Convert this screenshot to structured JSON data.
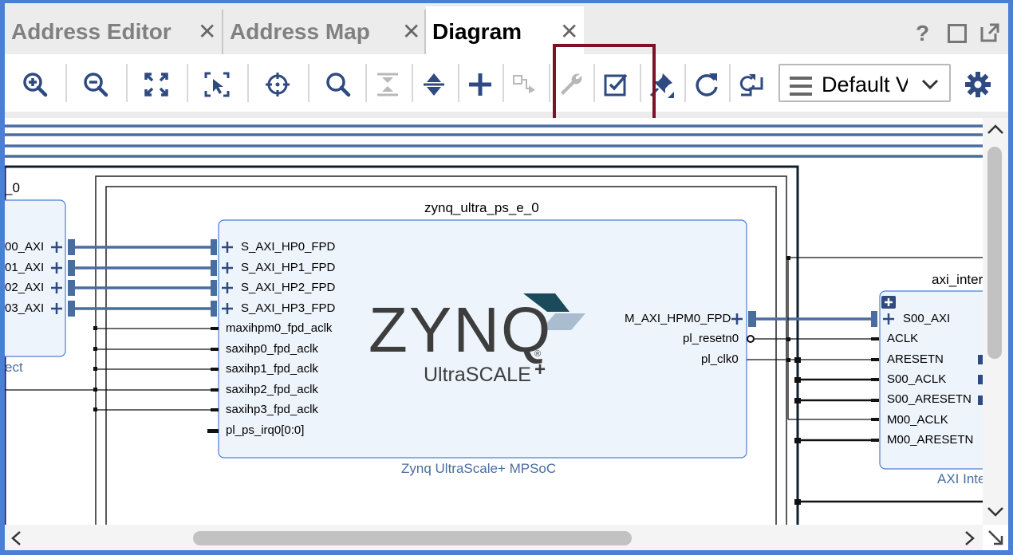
{
  "tabs": [
    {
      "label": "Address Editor",
      "active": false
    },
    {
      "label": "Address Map",
      "active": false
    },
    {
      "label": "Diagram",
      "active": true
    }
  ],
  "window_controls": [
    "help-icon",
    "maximize-icon",
    "float-icon"
  ],
  "window_help": "?",
  "toolbar": {
    "buttons": [
      "zoom-in-icon",
      "zoom-out-icon",
      "zoom-fit-icon",
      "zoom-area-icon",
      "center-icon",
      "search-icon",
      "collapse-icon",
      "expand-icon",
      "add-ip-icon",
      "make-connection-icon",
      "customize-wrench-icon",
      "validate-design-icon",
      "pin-icon",
      "regenerate-layout-icon",
      "optimize-routing-icon",
      "settings-gear-icon"
    ],
    "view_select_value": "Default V"
  },
  "colors": {
    "accent": "#4a7fd4",
    "highlight": "#7d1127",
    "net": "#4a6da0",
    "block_fill": "#eef4fb"
  },
  "diagram": {
    "left_block": {
      "title_suffix": "_0",
      "ports": [
        "00_AXI",
        "01_AXI",
        "02_AXI",
        "03_AXI"
      ],
      "caption": "ect"
    },
    "zynq": {
      "instance_name": "zynq_ultra_ps_e_0",
      "logo_text": "ZYNQ",
      "logo_reg": "®",
      "logo_sub": "UltraSCALE",
      "logo_plus": "+",
      "caption": "Zynq UltraScale+ MPSoC",
      "left_ports": [
        "S_AXI_HP0_FPD",
        "S_AXI_HP1_FPD",
        "S_AXI_HP2_FPD",
        "S_AXI_HP3_FPD",
        "maxihpm0_fpd_aclk",
        "saxihp0_fpd_aclk",
        "saxihp1_fpd_aclk",
        "saxihp2_fpd_aclk",
        "saxihp3_fpd_aclk",
        "pl_ps_irq0[0:0]"
      ],
      "right_ports": [
        "M_AXI_HPM0_FPD",
        "pl_resetn0",
        "pl_clk0"
      ]
    },
    "axi_inter": {
      "instance_name": "axi_inter",
      "ports": [
        "S00_AXI",
        "ACLK",
        "ARESETN",
        "S00_ACLK",
        "S00_ARESETN",
        "M00_ACLK",
        "M00_ARESETN"
      ],
      "caption": "AXI Inte"
    }
  }
}
